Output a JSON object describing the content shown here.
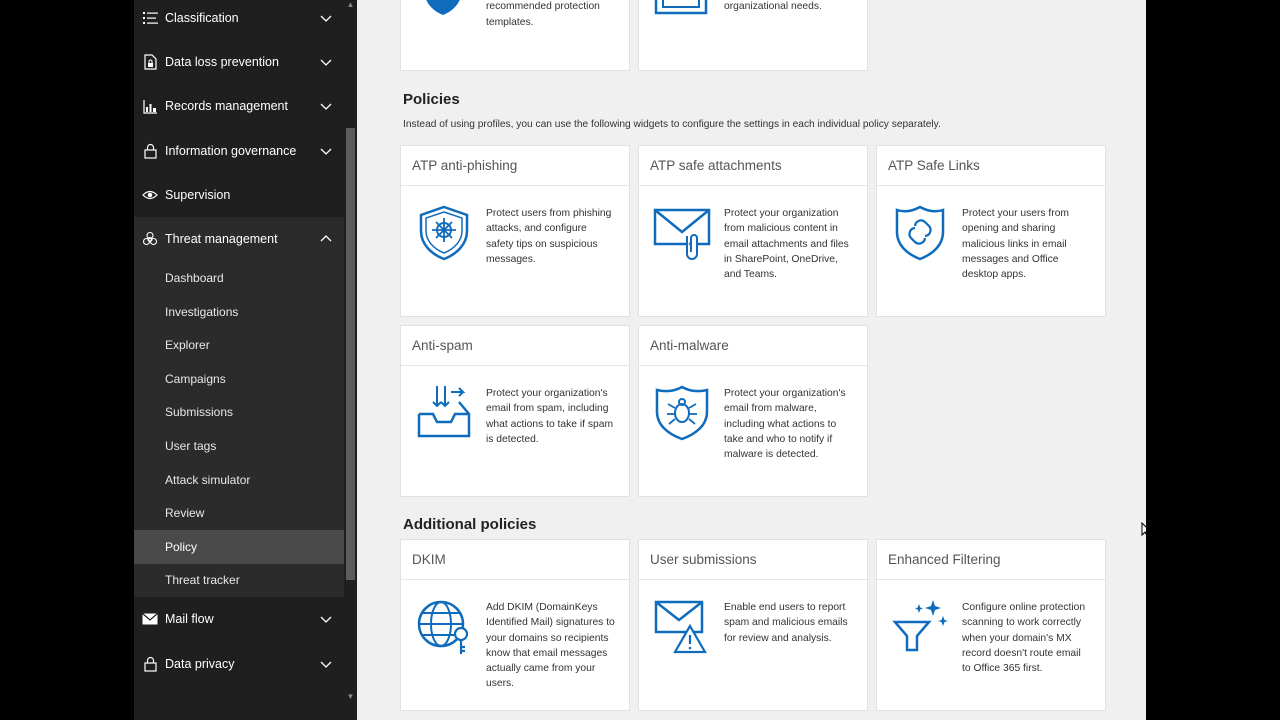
{
  "sidebar": {
    "items_top": [
      {
        "label": "Classification",
        "icon": "list-icon"
      },
      {
        "label": "Data loss prevention",
        "icon": "lock-document-icon"
      },
      {
        "label": "Records management",
        "icon": "records-chart-icon"
      },
      {
        "label": "Information governance",
        "icon": "lock-icon"
      },
      {
        "label": "Supervision",
        "icon": "eye-icon"
      },
      {
        "label": "Threat management",
        "icon": "biohazard-icon"
      }
    ],
    "threat_sub": [
      "Dashboard",
      "Investigations",
      "Explorer",
      "Campaigns",
      "Submissions",
      "User tags",
      "Attack simulator",
      "Review",
      "Policy",
      "Threat tracker"
    ],
    "active_sub": "Policy",
    "items_bottom": [
      {
        "label": "Mail flow",
        "icon": "mail-icon"
      },
      {
        "label": "Data privacy",
        "icon": "lock-icon"
      }
    ]
  },
  "top_cards": [
    {
      "text": "once using our recommended protection templates."
    },
    {
      "text": "can customize to fit your organizational needs."
    }
  ],
  "policies": {
    "title": "Policies",
    "subtitle": "Instead of using profiles, you can use the following widgets to configure the settings in each individual policy separately.",
    "cards": [
      {
        "title": "ATP anti-phishing",
        "icon": "phishing-shield-icon",
        "text": "Protect users from phishing attacks, and configure safety tips on suspicious messages."
      },
      {
        "title": "ATP safe attachments",
        "icon": "attachment-envelope-icon",
        "text": "Protect your organization from malicious content in email attachments and files in SharePoint, OneDrive, and Teams."
      },
      {
        "title": "ATP Safe Links",
        "icon": "link-shield-icon",
        "text": "Protect your users from opening and sharing malicious links in email messages and Office desktop apps."
      },
      {
        "title": "Anti-spam",
        "icon": "spam-inbox-icon",
        "text": "Protect your organization's email from spam, including what actions to take if spam is detected."
      },
      {
        "title": "Anti-malware",
        "icon": "malware-shield-icon",
        "text": "Protect your organization's email from malware, including what actions to take and who to notify if malware is detected."
      }
    ]
  },
  "additional": {
    "title": "Additional policies",
    "cards": [
      {
        "title": "DKIM",
        "icon": "globe-key-icon",
        "text": "Add DKIM (DomainKeys Identified Mail) signatures to your domains so recipients know that email messages actually came from your users."
      },
      {
        "title": "User submissions",
        "icon": "warning-envelope-icon",
        "text": "Enable end users to report spam and malicious emails for review and analysis."
      },
      {
        "title": "Enhanced Filtering",
        "icon": "sparkle-filter-icon",
        "text": "Configure online protection scanning to work correctly when your domain's MX record doesn't route email to Office 365 first."
      }
    ]
  },
  "colors": {
    "accent": "#0f6cbd",
    "sidebar_bg": "#1f1f1f",
    "sub_bg": "#2b2b2b",
    "active_bg": "#4a4a4a"
  }
}
